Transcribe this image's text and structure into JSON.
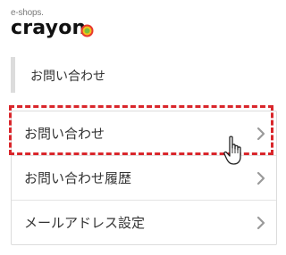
{
  "brand": {
    "small_text": "e-shops.",
    "name": "crayon"
  },
  "section": {
    "title": "お問い合わせ"
  },
  "menu": {
    "items": [
      {
        "label": "お問い合わせ",
        "icon": "chevron-right-icon"
      },
      {
        "label": "お問い合わせ履歴",
        "icon": "chevron-right-icon"
      },
      {
        "label": "メールアドレス設定",
        "icon": "chevron-right-icon"
      }
    ]
  },
  "annotation": {
    "highlight_color": "#d9262b",
    "cursor_icon": "hand-pointer-icon"
  }
}
